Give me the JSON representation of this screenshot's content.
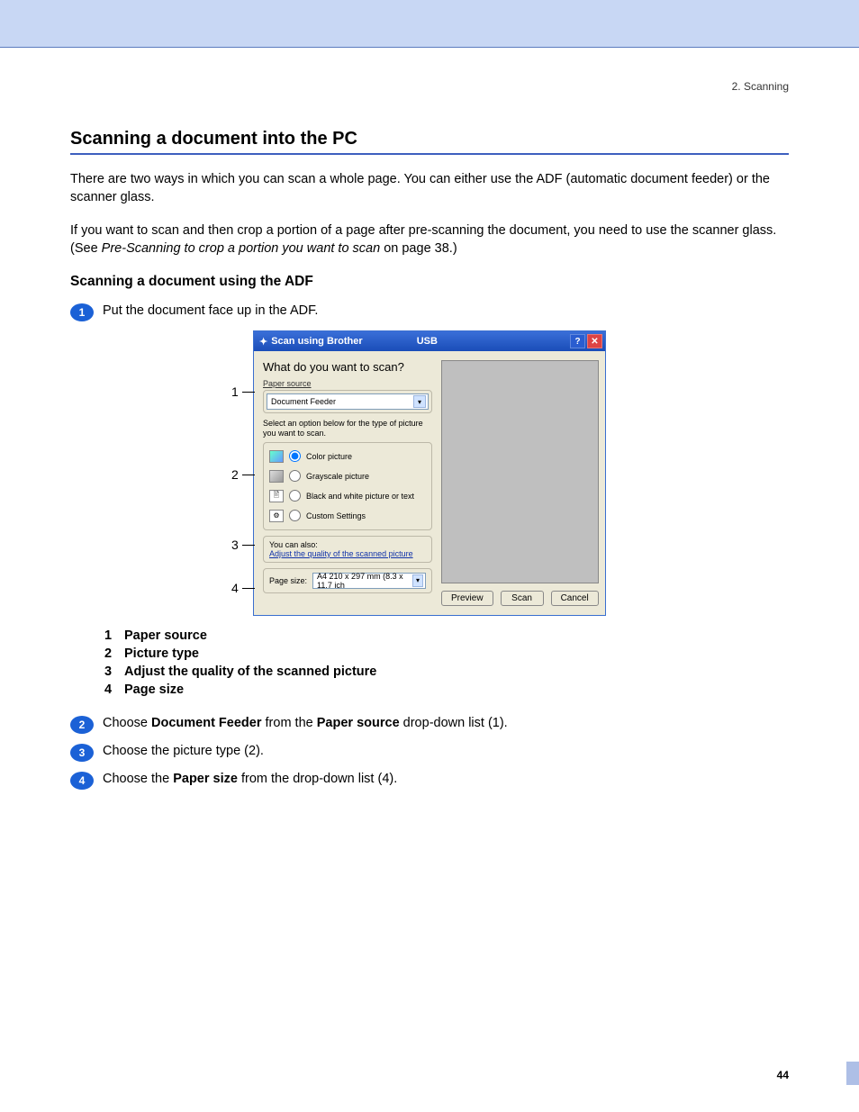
{
  "breadcrumb": "2. Scanning",
  "h1": "Scanning a document into the PC",
  "para1": "There are two ways in which you can scan a whole page. You can either use the ADF (automatic document feeder) or the scanner glass.",
  "para2_a": "If you want to scan and then crop a portion of a page after pre-scanning the document, you need to use the scanner glass. (See ",
  "para2_i": "Pre-Scanning to crop a portion you want to scan",
  "para2_b": " on page 38.)",
  "h2": "Scanning a document using the ADF",
  "step1": "Put the document face up in the ADF.",
  "callouts": {
    "c1": "1",
    "c2": "2",
    "c3": "3",
    "c4": "4"
  },
  "dialog": {
    "title": "Scan using Brother",
    "usb": "USB",
    "question": "What do you want to scan?",
    "paper_source_label": "Paper source",
    "paper_source_value": "Document Feeder",
    "select_caption": "Select an option below for the type of picture you want to scan.",
    "opt_color": "Color picture",
    "opt_gray": "Grayscale picture",
    "opt_bw": "Black and white picture or text",
    "opt_custom": "Custom Settings",
    "you_can_also": "You can also:",
    "adjust_link": "Adjust the quality of the scanned picture",
    "page_size_label": "Page size:",
    "page_size_value": "A4 210 x 297 mm (8.3 x 11.7 ich",
    "btn_preview": "Preview",
    "btn_scan": "Scan",
    "btn_cancel": "Cancel"
  },
  "legend": {
    "l1": "Paper source",
    "l2": "Picture type",
    "l3": "Adjust the quality of the scanned picture",
    "l4": "Page size"
  },
  "step2_a": "Choose ",
  "step2_b1": "Document Feeder",
  "step2_c": " from the ",
  "step2_b2": "Paper source",
  "step2_d": " drop-down list (1).",
  "step3": "Choose the picture type (2).",
  "step4_a": "Choose the ",
  "step4_b": "Paper size",
  "step4_c": " from the drop-down list (4).",
  "page_number": "44",
  "nums": {
    "n1": "1",
    "n2": "2",
    "n3": "3",
    "n4": "4"
  }
}
